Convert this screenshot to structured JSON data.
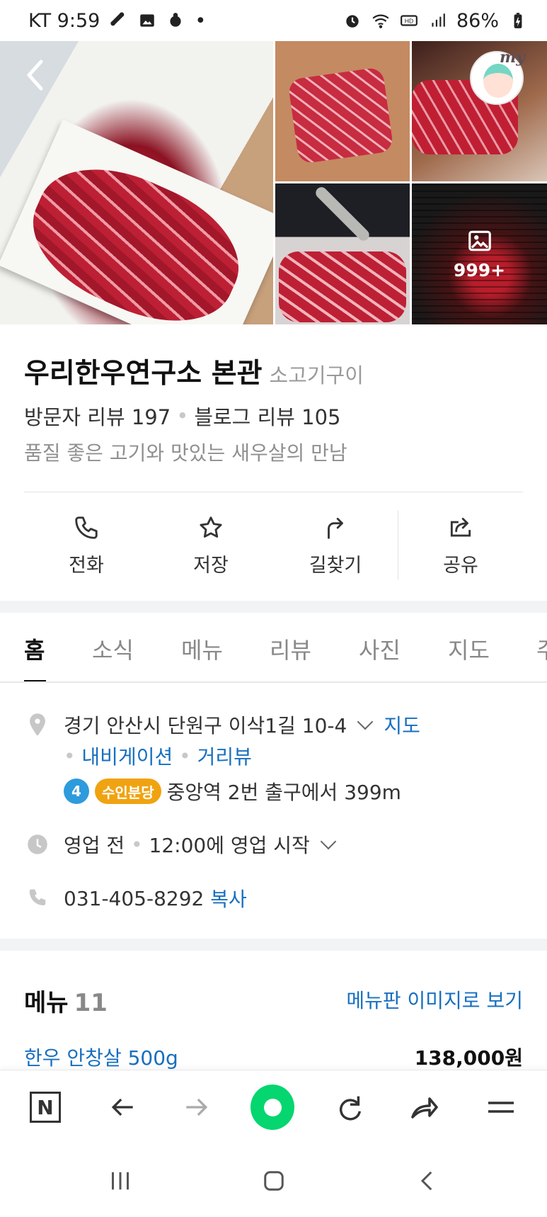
{
  "status_bar": {
    "carrier_time": "KT 9:59",
    "battery": "86%"
  },
  "gallery": {
    "more_count": "999+"
  },
  "profile": {
    "label": "my"
  },
  "place": {
    "name": "우리한우연구소 본관",
    "category": "소고기구이",
    "visitor_review": "방문자 리뷰 197",
    "blog_review": "블로그 리뷰 105",
    "description": "품질 좋은 고기와 맛있는 새우살의 만남"
  },
  "actions": [
    {
      "label": "전화",
      "icon": "phone-icon"
    },
    {
      "label": "저장",
      "icon": "star-icon"
    },
    {
      "label": "길찾기",
      "icon": "directions-icon"
    },
    {
      "label": "공유",
      "icon": "share-icon"
    }
  ],
  "tabs": [
    "홈",
    "소식",
    "메뉴",
    "리뷰",
    "사진",
    "지도",
    "주"
  ],
  "location": {
    "address": "경기 안산시 단원구 이삭1길 10-4",
    "map_link": "지도",
    "navigation_link": "내비게이션",
    "street_view_link": "거리뷰",
    "subway_line": "4",
    "subway_branch": "수인분당",
    "station_distance": "중앙역 2번 출구에서 399m"
  },
  "hours": {
    "status": "영업 전",
    "start_text": "12:00에 영업 시작"
  },
  "phone": {
    "number": "031-405-8292",
    "copy": "복사"
  },
  "menu": {
    "title": "메뉴",
    "count": "11",
    "image_link": "메뉴판 이미지로 보기",
    "items": [
      {
        "name": "한우 안창살 500g",
        "price": "138,000원"
      }
    ]
  },
  "colors": {
    "link": "#176fbf",
    "green_button": "#05d66f",
    "subway_badge": "#2e9bdd",
    "line_badge": "#f0a311"
  }
}
